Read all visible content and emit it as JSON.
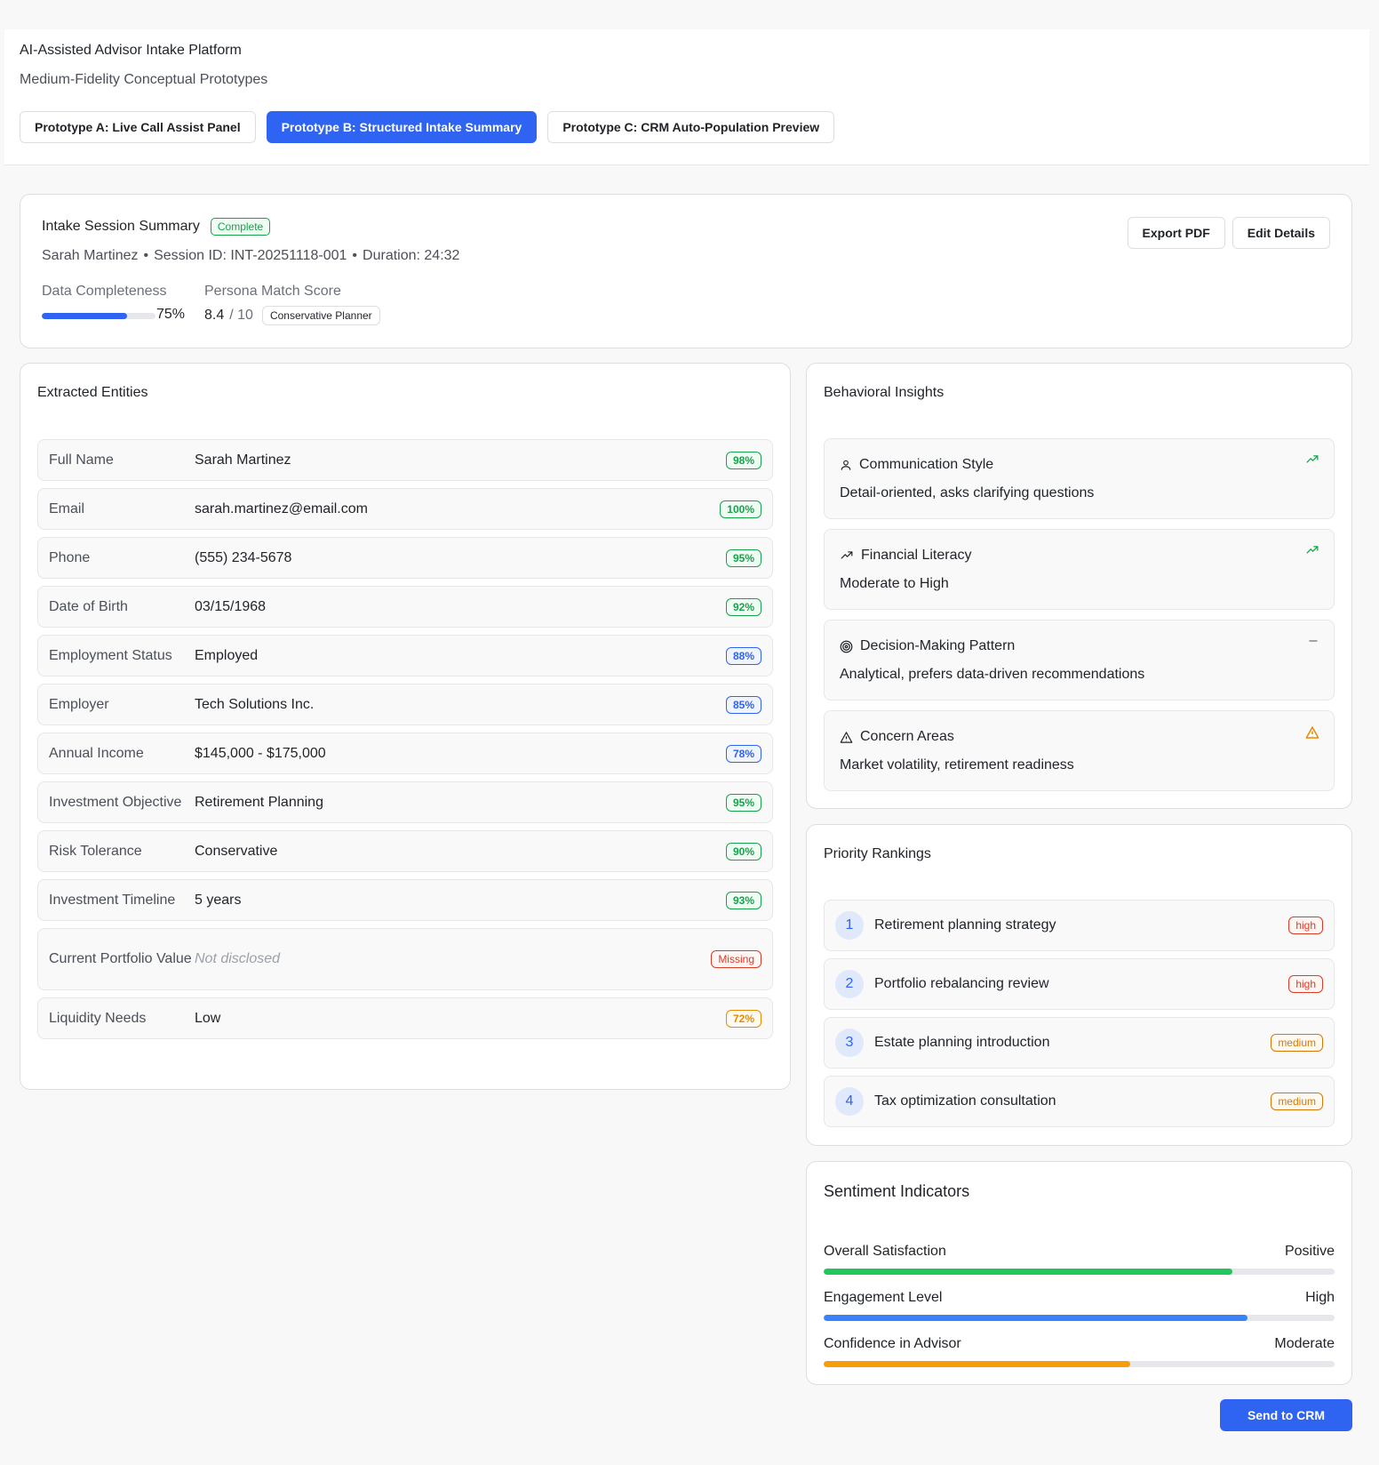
{
  "header": {
    "title": "AI-Assisted Advisor Intake Platform",
    "subtitle": "Medium-Fidelity Conceptual Prototypes",
    "tabs": [
      {
        "label": "Prototype A: Live Call Assist Panel",
        "active": false
      },
      {
        "label": "Prototype B: Structured Intake Summary",
        "active": true
      },
      {
        "label": "Prototype C: CRM Auto-Population Preview",
        "active": false
      }
    ]
  },
  "summary": {
    "title": "Intake Session Summary",
    "status": "Complete",
    "client_name": "Sarah Martinez",
    "separator": "•",
    "session_id": "Session ID: INT-20251118-001",
    "duration": "Duration: 24:32",
    "export_label": "Export PDF",
    "edit_label": "Edit Details",
    "completeness_label": "Data Completeness",
    "completeness_value": "75%",
    "completeness_fraction": 0.75,
    "persona_label": "Persona Match Score",
    "persona_score": "8.4",
    "persona_max": "/ 10",
    "persona_name": "Conservative Planner"
  },
  "entities": {
    "title": "Extracted Entities",
    "rows": [
      {
        "label": "Full Name",
        "value": "Sarah Martinez",
        "confidence": "98%",
        "tone": "green"
      },
      {
        "label": "Email",
        "value": "sarah.martinez@email.com",
        "confidence": "100%",
        "tone": "green"
      },
      {
        "label": "Phone",
        "value": "(555) 234-5678",
        "confidence": "95%",
        "tone": "green"
      },
      {
        "label": "Date of Birth",
        "value": "03/15/1968",
        "confidence": "92%",
        "tone": "green"
      },
      {
        "label": "Employment Status",
        "value": "Employed",
        "confidence": "88%",
        "tone": "blue"
      },
      {
        "label": "Employer",
        "value": "Tech Solutions Inc.",
        "confidence": "85%",
        "tone": "blue"
      },
      {
        "label": "Annual Income",
        "value": "$145,000 - $175,000",
        "confidence": "78%",
        "tone": "blue"
      },
      {
        "label": "Investment Objective",
        "value": "Retirement Planning",
        "confidence": "95%",
        "tone": "green"
      },
      {
        "label": "Risk Tolerance",
        "value": "Conservative",
        "confidence": "90%",
        "tone": "green"
      },
      {
        "label": "Investment Timeline",
        "value": "5 years",
        "confidence": "93%",
        "tone": "green"
      },
      {
        "label": "Current Portfolio Value",
        "value": "Not disclosed",
        "confidence": "Missing",
        "tone": "red"
      },
      {
        "label": "Liquidity Needs",
        "value": "Low",
        "confidence": "72%",
        "tone": "orange"
      }
    ]
  },
  "behavior": {
    "title": "Behavioral Insights",
    "items": [
      {
        "title": "Communication Style",
        "text": "Detail-oriented, asks clarifying questions",
        "icon": "user-icon",
        "trend": "trend-up-icon"
      },
      {
        "title": "Financial Literacy",
        "text": "Moderate to High",
        "icon": "trending-up-icon",
        "trend": "trend-up-icon"
      },
      {
        "title": "Decision-Making Pattern",
        "text": "Analytical, prefers data-driven recommendations",
        "icon": "target-icon",
        "trend": "minus-icon"
      },
      {
        "title": "Concern Areas",
        "text": "Market volatility, retirement readiness",
        "icon": "alert-triangle-icon",
        "trend": "warning-icon"
      }
    ]
  },
  "priority": {
    "title": "Priority Rankings",
    "items": [
      {
        "rank": "1",
        "text": "Retirement planning strategy",
        "level": "high"
      },
      {
        "rank": "2",
        "text": "Portfolio rebalancing review",
        "level": "high"
      },
      {
        "rank": "3",
        "text": "Estate planning introduction",
        "level": "medium"
      },
      {
        "rank": "4",
        "text": "Tax optimization consultation",
        "level": "medium"
      }
    ]
  },
  "sentiment": {
    "title": "Sentiment Indicators",
    "items": [
      {
        "label": "Overall Satisfaction",
        "value": "Positive",
        "fraction": 0.8,
        "color": "#22c55e"
      },
      {
        "label": "Engagement Level",
        "value": "High",
        "fraction": 0.83,
        "color": "#3b82f6"
      },
      {
        "label": "Confidence in Advisor",
        "value": "Moderate",
        "fraction": 0.6,
        "color": "#f59e0b"
      }
    ]
  },
  "actions": {
    "send_label": "Send to CRM"
  },
  "colors": {
    "accent": "#2f63f1",
    "success": "#16a34a",
    "warning": "#ea8a00",
    "danger": "#dc3b26"
  }
}
